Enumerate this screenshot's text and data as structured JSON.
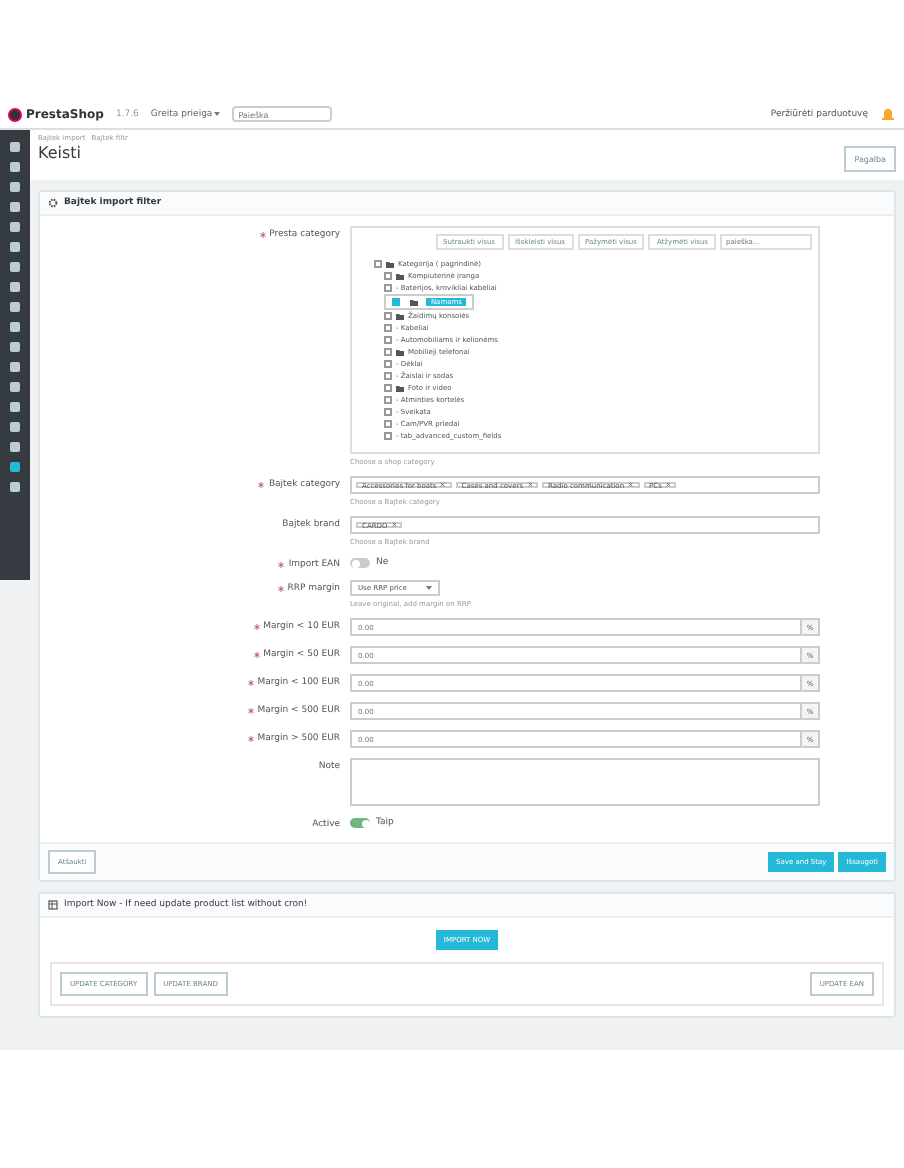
{
  "header": {
    "logo": "PrestaShop",
    "version": "1.7.6",
    "quick_access": "Greita prieiga",
    "search": {
      "placeholder": "Paieška"
    },
    "view_shop": "Peržiūrėti parduotuvę"
  },
  "sidebar": {
    "items": [
      {
        "selected": false
      },
      {
        "selected": false
      },
      {
        "selected": false
      },
      {
        "selected": false
      },
      {
        "selected": false
      },
      {
        "selected": false
      },
      {
        "selected": false
      },
      {
        "selected": false
      },
      {
        "selected": false
      },
      {
        "selected": false
      },
      {
        "selected": false
      },
      {
        "selected": false
      },
      {
        "selected": false
      },
      {
        "selected": false
      },
      {
        "selected": false
      },
      {
        "selected": false
      },
      {
        "selected": true
      },
      {
        "selected": false
      }
    ]
  },
  "breadcrumb": [
    "Bajtek import",
    "Bajtek filtr"
  ],
  "title": "Keisti",
  "help_button": "Pagalba",
  "panel": {
    "title": "Bajtek import filter",
    "tree_field": {
      "label": "Presta category",
      "required": true,
      "tree_buttons": [
        {
          "label": "Sutraukti visus"
        },
        {
          "label": "Išskleisti visus"
        },
        {
          "label": "Pažymėti visus"
        },
        {
          "label": "Atžymėti visus"
        }
      ],
      "tree_search": {
        "placeholder": "paieška..."
      },
      "tree": [
        {
          "label": "Kategorija ( pagrindinė)",
          "folder": true,
          "checked": false,
          "children": [
            {
              "label": "Kompiuterinė įranga",
              "folder": true,
              "checked": false
            },
            {
              "label": "- Baterijos, krovikliai kabeliai",
              "folder": false,
              "checked": false
            },
            {
              "label": "Namams",
              "folder": true,
              "checked": true
            },
            {
              "label": "Žaidimų konsolės",
              "folder": true,
              "checked": false
            },
            {
              "label": "- Kabeliai",
              "folder": false,
              "checked": false
            },
            {
              "label": "- Automobiliams ir kelionėms",
              "folder": false,
              "checked": false
            },
            {
              "label": "Mobilieji telefonai",
              "folder": true,
              "checked": false
            },
            {
              "label": "- Dėklai",
              "folder": false,
              "checked": false
            },
            {
              "label": "- Žaislai ir sodas",
              "folder": false,
              "checked": false
            },
            {
              "label": "Foto ir video",
              "folder": true,
              "checked": false
            },
            {
              "label": "- Atminties kortelės",
              "folder": false,
              "checked": false
            },
            {
              "label": "- Sveikata",
              "folder": false,
              "checked": false
            },
            {
              "label": "- Cam/PVR priedai",
              "folder": false,
              "checked": false
            },
            {
              "label": "- tab_advanced_custom_fields",
              "folder": false,
              "checked": false
            }
          ]
        }
      ],
      "help": "Choose a shop category"
    },
    "fields": [
      {
        "kind": "tags",
        "label": "Bajtek category",
        "required": true,
        "tags": [
          "Accessories for boats",
          "Cases and covers",
          "Radio communication",
          "PCs"
        ],
        "help": "Choose a Bajtek category"
      },
      {
        "kind": "tags",
        "label": "Bajtek brand",
        "required": false,
        "tags": [
          "CARDO"
        ],
        "help": "Choose a Bajtek brand"
      },
      {
        "kind": "switch",
        "label": "Import EAN",
        "required": true,
        "on": false,
        "text": "Ne"
      },
      {
        "kind": "select",
        "label": "RRP margin",
        "required": true,
        "value": "Use RRP price",
        "help": "Leave original, add margin on RRP"
      },
      {
        "kind": "number",
        "label": "Margin < 10 EUR",
        "required": true,
        "value": "0.00",
        "suffix": "%"
      },
      {
        "kind": "number",
        "label": "Margin < 50 EUR",
        "required": true,
        "value": "0.00",
        "suffix": "%"
      },
      {
        "kind": "number",
        "label": "Margin < 100 EUR",
        "required": true,
        "value": "0.00",
        "suffix": "%"
      },
      {
        "kind": "number",
        "label": "Margin < 500 EUR",
        "required": true,
        "value": "0.00",
        "suffix": "%"
      },
      {
        "kind": "number",
        "label": "Margin > 500 EUR",
        "required": true,
        "value": "0.00",
        "suffix": "%"
      },
      {
        "kind": "textarea",
        "label": "Note",
        "required": false
      },
      {
        "kind": "switch",
        "label": "Active",
        "required": false,
        "on": true,
        "text": "Taip"
      }
    ],
    "cancel": "Atšaukti",
    "save_stay": "Save and Stay",
    "save": "Išsaugoti"
  },
  "import_panel": {
    "title": "Import Now - If need update product list without cron!",
    "import_button": "IMPORT NOW",
    "buttons": [
      "UPDATE CATEGORY",
      "UPDATE BRAND"
    ],
    "right_button": "UPDATE EAN"
  }
}
